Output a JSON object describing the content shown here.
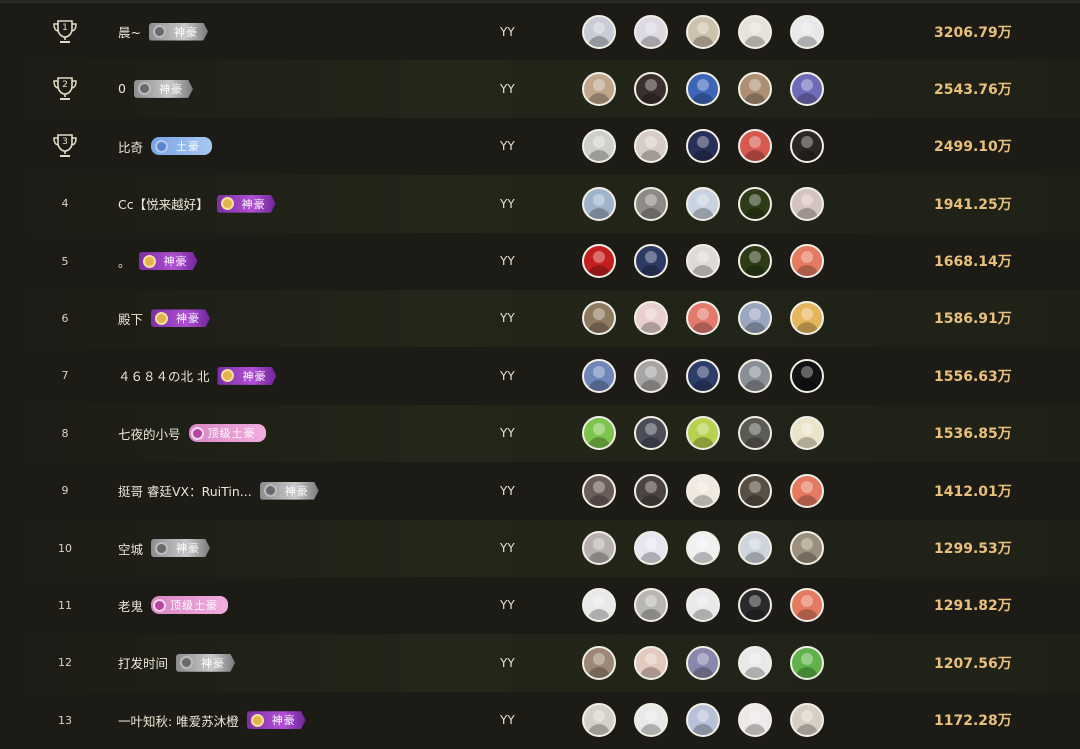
{
  "platform_label": "YY",
  "rows": [
    {
      "rank": "1",
      "name": "晨~",
      "badge": "神豪",
      "tier": "silver",
      "amount": "3206.79万",
      "avatars": [
        "#c9cbd6",
        "#dcd9e2",
        "#cfc2ac",
        "#e6e2dc",
        "#e9e9e9"
      ]
    },
    {
      "rank": "2",
      "name": "0",
      "badge": "神豪",
      "tier": "silver",
      "amount": "2543.76万",
      "avatars": [
        "#c0a78c",
        "#3a2f2d",
        "#3d66b8",
        "#ad8f74",
        "#6f6bb9"
      ]
    },
    {
      "rank": "3",
      "name": "比奇",
      "badge": "土豪",
      "tier": "blue",
      "amount": "2499.10万",
      "avatars": [
        "#cfd0cc",
        "#d6cdc6",
        "#283058",
        "#d6584f",
        "#2b2725"
      ]
    },
    {
      "rank": "4",
      "name": "Cc【悦来越好】",
      "badge": "神豪",
      "tier": "purple",
      "amount": "1941.25万",
      "avatars": [
        "#9fb3c9",
        "#8e8a86",
        "#c8d2e0",
        "#2e3b17",
        "#d4c3c0"
      ]
    },
    {
      "rank": "5",
      "name": "。",
      "badge": "神豪",
      "tier": "purple",
      "amount": "1668.14万",
      "avatars": [
        "#c51e1e",
        "#2e3a66",
        "#dedbd6",
        "#2e3b17",
        "#e47a5f"
      ]
    },
    {
      "rank": "6",
      "name": "殿下",
      "badge": "神豪",
      "tier": "purple",
      "amount": "1586.91万",
      "avatars": [
        "#8f7b62",
        "#e9cfcf",
        "#e47a6d",
        "#98a6bf",
        "#e6b65c"
      ]
    },
    {
      "rank": "7",
      "name": "４６８４の北 北",
      "badge": "神豪",
      "tier": "purple",
      "amount": "1556.63万",
      "avatars": [
        "#6e86b8",
        "#a8a6a4",
        "#2d3e6b",
        "#8a8f96",
        "#101214"
      ]
    },
    {
      "rank": "8",
      "name": "七夜的小号",
      "badge": "顶级土豪",
      "tier": "pink",
      "amount": "1536.85万",
      "avatars": [
        "#7ec54d",
        "#4a4d58",
        "#b7d24e",
        "#5c5a54",
        "#ece4c9"
      ]
    },
    {
      "rank": "9",
      "name": "挺哥 睿廷VX：RuiTin...",
      "badge": "神豪",
      "tier": "silver",
      "amount": "1412.01万",
      "avatars": [
        "#6b5d59",
        "#4b4341",
        "#f1e9e0",
        "#574e44",
        "#e47a5f"
      ]
    },
    {
      "rank": "10",
      "name": "空城",
      "badge": "神豪",
      "tier": "silver",
      "amount": "1299.53万",
      "avatars": [
        "#b7b2ae",
        "#e6e6f0",
        "#f1f1f1",
        "#cfd5de",
        "#9d8f7d"
      ]
    },
    {
      "rank": "11",
      "name": "老鬼",
      "badge": "顶级土豪",
      "tier": "pink",
      "amount": "1291.82万",
      "avatars": [
        "#e9e9e9",
        "#b9b7b4",
        "#e9e9e9",
        "#2a2a2c",
        "#e47a5f"
      ]
    },
    {
      "rank": "12",
      "name": "打发时间",
      "badge": "神豪",
      "tier": "silver",
      "amount": "1207.56万",
      "avatars": [
        "#9c8874",
        "#e4c9bf",
        "#8a87ad",
        "#e9e9e9",
        "#5fb34a"
      ]
    },
    {
      "rank": "13",
      "name": "一叶知秋: 唯爱苏沐橙",
      "badge": "神豪",
      "tier": "purple",
      "amount": "1172.28万",
      "avatars": [
        "#d6d0ca",
        "#e9e9e9",
        "#b7c1d8",
        "#efe9e9",
        "#d8cfc4"
      ]
    }
  ]
}
